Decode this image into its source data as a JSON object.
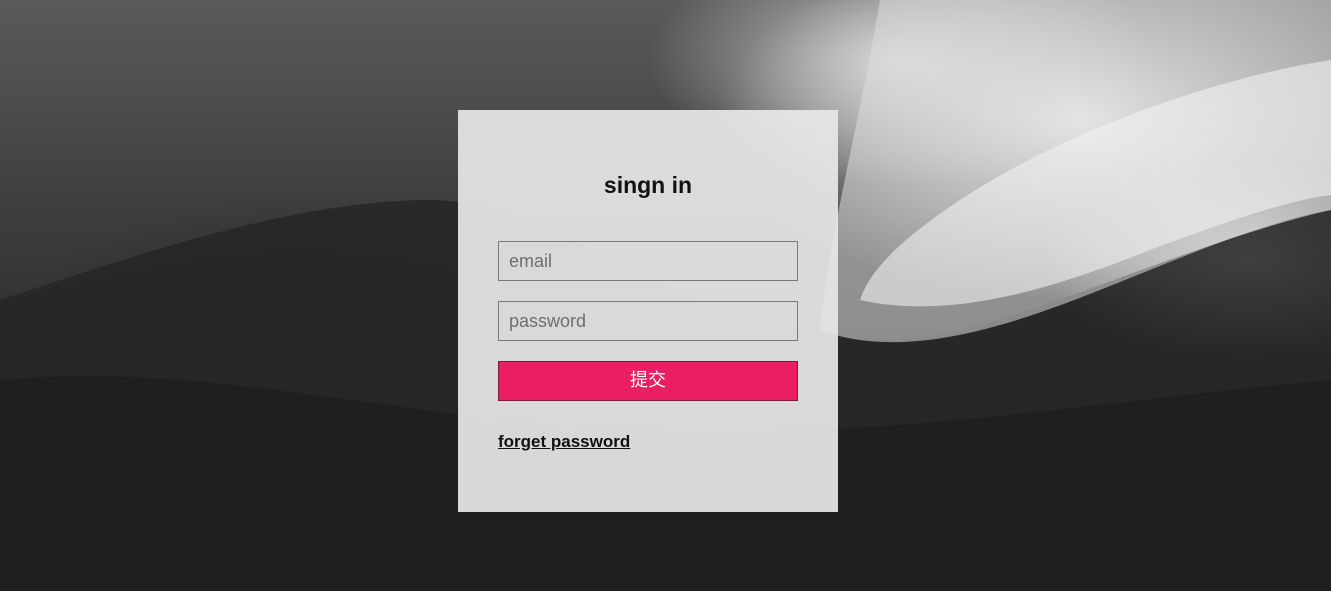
{
  "form": {
    "title": "singn in",
    "email_placeholder": "email",
    "password_placeholder": "password",
    "submit_label": "提交",
    "forgot_label": "forget password"
  },
  "colors": {
    "accent": "#e91e63",
    "card_background": "#e8e8e8",
    "background": "#2e2e2e"
  }
}
